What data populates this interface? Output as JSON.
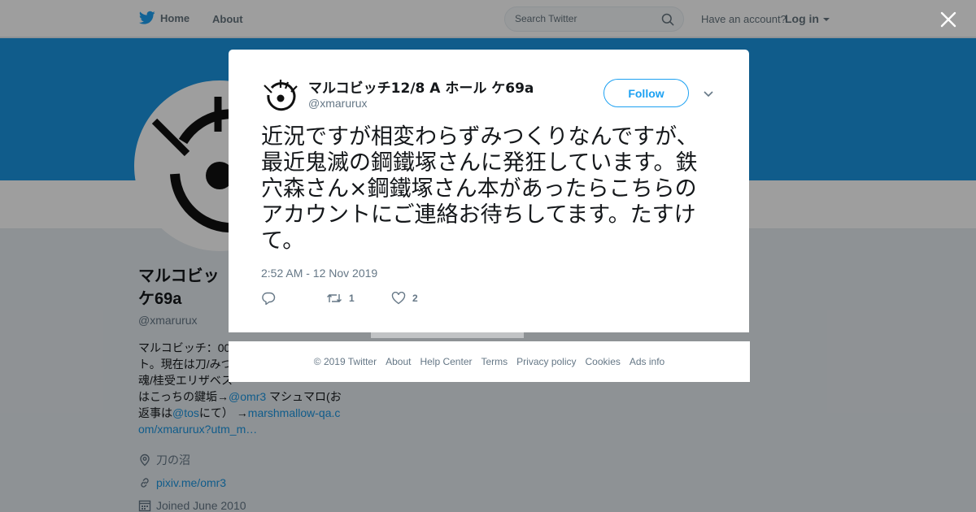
{
  "nav": {
    "home_label": "Home",
    "about_label": "About",
    "search_placeholder": "Search Twitter",
    "have_account": "Have an account?",
    "login_label": "Log in"
  },
  "profile": {
    "name": "マルコビッ\nケ69a",
    "handle": "@xmarurux",
    "bio_plain_1": "マルコビッチ：00",
    "bio_plain_2": "ト。現在は刀/みつ",
    "bio_plain_3": "魂/桂受エリザベス",
    "bio_plain_4": "はこっちの鍵垢→",
    "bio_link_1": "@omr3",
    "bio_plain_5": " マシュマロ(お",
    "bio_plain_6": "返事は",
    "bio_link_2": "@tos",
    "bio_plain_7": "にて） →",
    "bio_link_3": "marshmallow-qa.com/xmarurux?utm_m…",
    "location": "刀の沼",
    "website": "pixiv.me/omr3",
    "joined": "Joined June 2010"
  },
  "tweet": {
    "author_name": "マルコビッチ12/8 A ホール ケ69a",
    "author_handle": "@xmarurux",
    "follow_label": "Follow",
    "text": "近況ですが相変わらずみつくりなんですが、最近鬼滅の鋼鐵塚さんに発狂しています。鉄穴森さん×鋼鐵塚さん本があったらこちらのアカウントにご連絡お待ちしてます。たすけて。",
    "timestamp": "2:52 AM - 12 Nov 2019",
    "retweets": "1",
    "likes": "2"
  },
  "footer": {
    "links": [
      "© 2019 Twitter",
      "About",
      "Help Center",
      "Terms",
      "Privacy policy",
      "Cookies",
      "Ads info"
    ]
  },
  "colors": {
    "twitter_blue": "#1da1f2",
    "banner": "#1b95e0",
    "muted": "#657786"
  },
  "icons": [
    "twitter-bird-icon",
    "search-icon",
    "caret-down-icon",
    "close-icon",
    "reply-icon",
    "retweet-icon",
    "heart-icon",
    "location-icon",
    "link-icon",
    "calendar-icon"
  ]
}
